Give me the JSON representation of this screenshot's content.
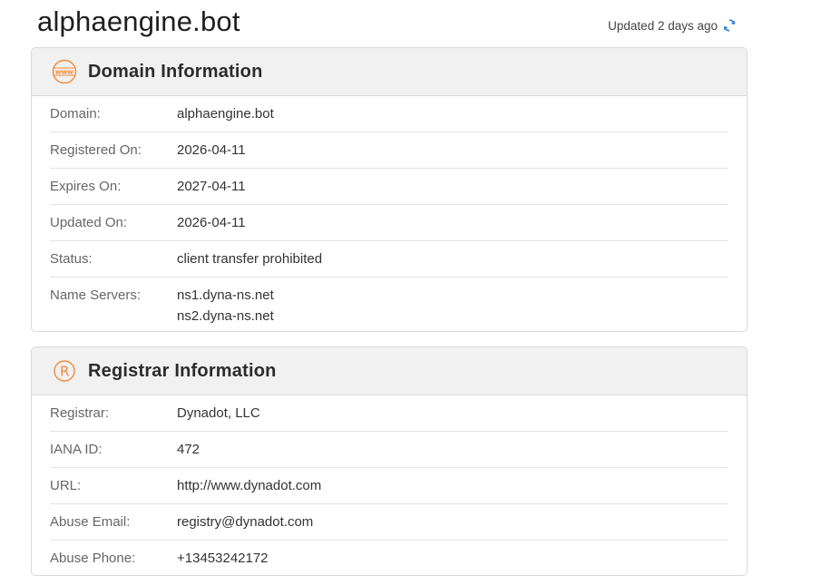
{
  "header": {
    "domain_title": "alphaengine.bot",
    "updated_text": "Updated 2 days ago"
  },
  "domain_info": {
    "title": "Domain Information",
    "rows": [
      {
        "label": "Domain:",
        "value": "alphaengine.bot"
      },
      {
        "label": "Registered On:",
        "value": "2026-04-11"
      },
      {
        "label": "Expires On:",
        "value": "2027-04-11"
      },
      {
        "label": "Updated On:",
        "value": "2026-04-11"
      },
      {
        "label": "Status:",
        "value": "client transfer prohibited"
      }
    ],
    "name_servers": {
      "label": "Name Servers:",
      "values": [
        "ns1.dyna-ns.net",
        "ns2.dyna-ns.net"
      ]
    }
  },
  "registrar_info": {
    "title": "Registrar Information",
    "rows": [
      {
        "label": "Registrar:",
        "value": "Dynadot, LLC"
      },
      {
        "label": "IANA ID:",
        "value": "472"
      },
      {
        "label": "URL:",
        "value": "http://www.dynadot.com"
      },
      {
        "label": "Abuse Email:",
        "value": "registry@dynadot.com"
      },
      {
        "label": "Abuse Phone:",
        "value": "+13453242172"
      }
    ]
  },
  "icons": {
    "domain_section": "www-icon",
    "registrar_section": "registered-icon",
    "refresh": "refresh-icon"
  },
  "colors": {
    "accent_orange": "#f08a3c",
    "refresh_blue": "#2f7fd6",
    "header_bg": "#f1f1f1"
  }
}
